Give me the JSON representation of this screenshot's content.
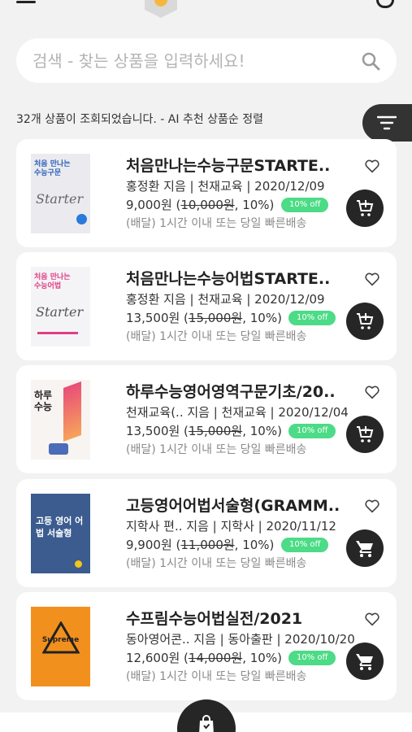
{
  "search": {
    "placeholder": "검색 - 찾는 상품을 입력하세요!"
  },
  "result_info": "32개 상품이 조회되었습니다. - AI 추천 상품순 정렬",
  "icons": {
    "menu": "menu-icon",
    "logo": "logo-icon",
    "user": "user-icon",
    "search": "search-icon",
    "filter": "filter-icon",
    "heart": "heart-icon",
    "add_cart": "add-to-cart-icon",
    "cart": "cart-icon",
    "bag": "shopping-bag-icon"
  },
  "colors": {
    "badge": "#4cdb86",
    "dark_button": "#262626",
    "background": "#f2f2f2"
  },
  "products": [
    {
      "title": "처음만나는수능구문STARTE..",
      "meta": "홍정환 지음 | 천재교육 | 2020/12/09",
      "price": "9,000원 (",
      "original_price": "10,000원",
      "discount": ", 10%)",
      "badge": "10% off",
      "delivery": "(배달) 1시간 이내 또는 당일 빠른배송",
      "cart_icon": "add-to-cart-icon",
      "cover_title": "처음 만나는 수능구문",
      "cover_script": "Starter"
    },
    {
      "title": "처음만나는수능어법STARTE..",
      "meta": "홍정환 지음 | 천재교육 | 2020/12/09",
      "price": "13,500원 (",
      "original_price": "15,000원",
      "discount": ", 10%)",
      "badge": "10% off",
      "delivery": "(배달) 1시간 이내 또는 당일 빠른배송",
      "cart_icon": "add-to-cart-icon",
      "cover_title": "처음 만나는 수능어법",
      "cover_script": "Starter"
    },
    {
      "title": "하루수능영어영역구문기초/20..",
      "meta": "천재교육(.. 지음 | 천재교육 | 2020/12/04",
      "price": "13,500원 (",
      "original_price": "15,000원",
      "discount": ", 10%)",
      "badge": "10% off",
      "delivery": "(배달) 1시간 이내 또는 당일 빠른배송",
      "cart_icon": "add-to-cart-icon",
      "cover_title": "하루 수능"
    },
    {
      "title": "고등영어어법서술형(GRAMM..",
      "meta": "지학사 편.. 지음 | 지학사 | 2020/11/12",
      "price": "9,900원 (",
      "original_price": "11,000원",
      "discount": ", 10%)",
      "badge": "10% off",
      "delivery": "(배달) 1시간 이내 또는 당일 빠른배송",
      "cart_icon": "cart-icon",
      "cover_title": "고등 영어 어법 서술형"
    },
    {
      "title": "수프림수능어법실전/2021",
      "meta": "동아영어콘.. 지음 | 동아출판 | 2020/10/20",
      "price": "12,600원 (",
      "original_price": "14,000원",
      "discount": ", 10%)",
      "badge": "10% off",
      "delivery": "(배달) 1시간 이내 또는 당일 빠른배송",
      "cart_icon": "cart-icon",
      "cover_title": "Supreme"
    }
  ]
}
